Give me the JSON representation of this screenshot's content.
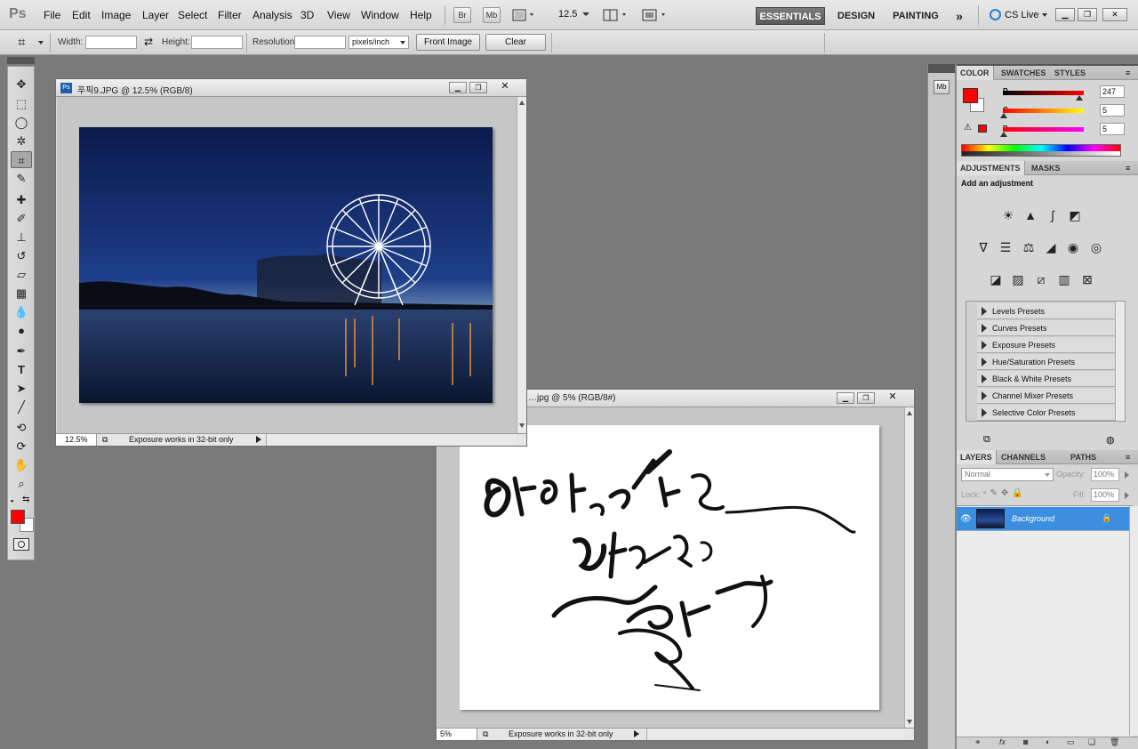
{
  "app": {
    "logo": "Ps"
  },
  "menu": [
    "File",
    "Edit",
    "Image",
    "Layer",
    "Select",
    "Filter",
    "Analysis",
    "3D",
    "View",
    "Window",
    "Help"
  ],
  "appbar": {
    "bridge": "Br",
    "minibridge": "Mb",
    "zoom": "12.5",
    "workspaces": [
      "ESSENTIALS",
      "DESIGN",
      "PAINTING"
    ],
    "active_workspace": "ESSENTIALS",
    "more": "»",
    "cslive": "CS Live"
  },
  "options": {
    "width_label": "Width:",
    "height_label": "Height:",
    "resolution_label": "Resolution:",
    "units": "pixels/inch",
    "front_image": "Front Image",
    "clear": "Clear"
  },
  "doc1": {
    "title": "푸픽9.JPG @ 12.5% (RGB/8)",
    "zoom": "12.5%",
    "status": "Exposure works in 32-bit only"
  },
  "doc2": {
    "title": "…jpg @ 5% (RGB/8#)",
    "zoom": "5%",
    "status": "Exposure works in 32-bit only"
  },
  "color_panel": {
    "tabs": [
      "COLOR",
      "SWATCHES",
      "STYLES"
    ],
    "channels": [
      {
        "label": "R",
        "value": "247"
      },
      {
        "label": "G",
        "value": "5"
      },
      {
        "label": "B",
        "value": "5"
      }
    ],
    "foreground": "#f70505"
  },
  "adjustments_panel": {
    "tabs": [
      "ADJUSTMENTS",
      "MASKS"
    ],
    "heading": "Add an adjustment",
    "presets": [
      "Levels Presets",
      "Curves Presets",
      "Exposure Presets",
      "Hue/Saturation Presets",
      "Black & White Presets",
      "Channel Mixer Presets",
      "Selective Color Presets"
    ]
  },
  "layers_panel": {
    "tabs": [
      "LAYERS",
      "CHANNELS",
      "PATHS"
    ],
    "blend_mode": "Normal",
    "opacity_label": "Opacity:",
    "opacity": "100%",
    "lock_label": "Lock:",
    "fill_label": "Fill:",
    "fill": "100%",
    "layers": [
      {
        "name": "Background",
        "selected": true
      }
    ]
  },
  "colors": {
    "accent": "#3c8fe0",
    "fg": "#ff0000"
  }
}
